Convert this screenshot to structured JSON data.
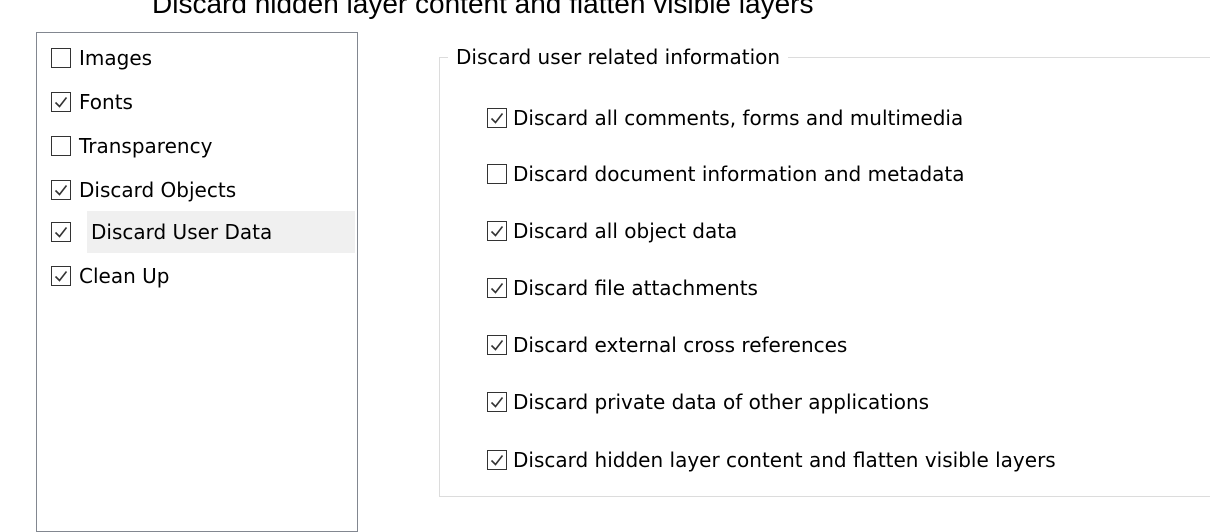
{
  "header": {
    "cut_text": "Discard hidden layer content and flatten visible layers"
  },
  "categories": [
    {
      "label": "Images",
      "checked": false,
      "selected": false
    },
    {
      "label": "Fonts",
      "checked": true,
      "selected": false
    },
    {
      "label": "Transparency",
      "checked": false,
      "selected": false
    },
    {
      "label": "Discard Objects",
      "checked": true,
      "selected": false
    },
    {
      "label": "Discard User Data",
      "checked": true,
      "selected": true
    },
    {
      "label": "Clean Up",
      "checked": true,
      "selected": false
    }
  ],
  "group": {
    "title": "Discard user related information",
    "options": [
      {
        "label": "Discard all comments, forms and multimedia",
        "checked": true
      },
      {
        "label": "Discard document information and metadata",
        "checked": false
      },
      {
        "label": "Discard all object data",
        "checked": true
      },
      {
        "label": "Discard file attachments",
        "checked": true
      },
      {
        "label": "Discard external cross references",
        "checked": true
      },
      {
        "label": "Discard private data of other applications",
        "checked": true
      },
      {
        "label": "Discard hidden layer content and flatten visible layers",
        "checked": true
      }
    ]
  },
  "colors": {
    "selection_background": "#f0f0f0",
    "list_border": "#828790",
    "group_border": "#dcdcdc",
    "checkmark": "#333333"
  }
}
